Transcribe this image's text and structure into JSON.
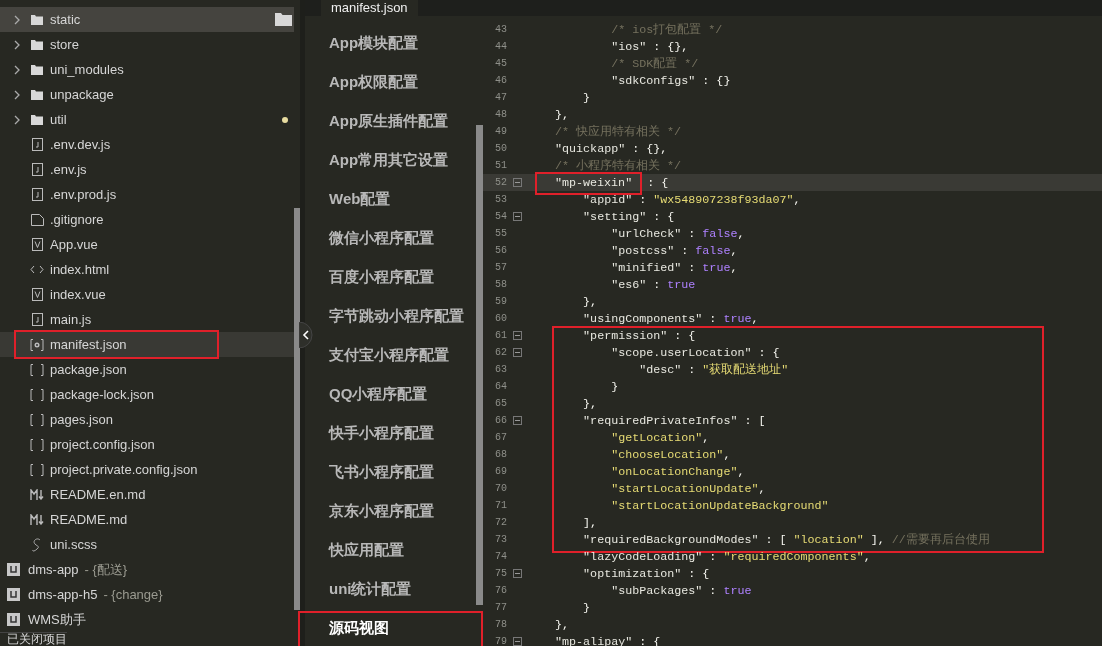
{
  "sidebar": {
    "items": [
      {
        "kind": "folder",
        "label": "static",
        "hovered": true,
        "selected": false,
        "modified": false
      },
      {
        "kind": "folder",
        "label": "store",
        "hovered": false,
        "selected": false,
        "modified": false
      },
      {
        "kind": "folder",
        "label": "uni_modules",
        "hovered": false,
        "selected": false,
        "modified": false
      },
      {
        "kind": "folder",
        "label": "unpackage",
        "hovered": false,
        "selected": false,
        "modified": false
      },
      {
        "kind": "folder",
        "label": "util",
        "hovered": false,
        "selected": false,
        "modified": true
      },
      {
        "kind": "js",
        "label": ".env.dev.js",
        "hovered": false,
        "selected": false,
        "modified": false
      },
      {
        "kind": "js",
        "label": ".env.js",
        "hovered": false,
        "selected": false,
        "modified": false
      },
      {
        "kind": "js",
        "label": ".env.prod.js",
        "hovered": false,
        "selected": false,
        "modified": false
      },
      {
        "kind": "blank",
        "label": ".gitignore",
        "hovered": false,
        "selected": false,
        "modified": false
      },
      {
        "kind": "vue",
        "label": "App.vue",
        "hovered": false,
        "selected": false,
        "modified": false
      },
      {
        "kind": "html",
        "label": "index.html",
        "hovered": false,
        "selected": false,
        "modified": false
      },
      {
        "kind": "vue",
        "label": "index.vue",
        "hovered": false,
        "selected": false,
        "modified": false
      },
      {
        "kind": "js",
        "label": "main.js",
        "hovered": false,
        "selected": false,
        "modified": false
      },
      {
        "kind": "manifest",
        "label": "manifest.json",
        "hovered": false,
        "selected": true,
        "modified": false,
        "annotated": true
      },
      {
        "kind": "json",
        "label": "package.json",
        "hovered": false,
        "selected": false,
        "modified": false
      },
      {
        "kind": "json",
        "label": "package-lock.json",
        "hovered": false,
        "selected": false,
        "modified": false
      },
      {
        "kind": "json",
        "label": "pages.json",
        "hovered": false,
        "selected": false,
        "modified": false
      },
      {
        "kind": "json",
        "label": "project.config.json",
        "hovered": false,
        "selected": false,
        "modified": false
      },
      {
        "kind": "json",
        "label": "project.private.config.json",
        "hovered": false,
        "selected": false,
        "modified": false
      },
      {
        "kind": "md",
        "label": "README.en.md",
        "hovered": false,
        "selected": false,
        "modified": false
      },
      {
        "kind": "md",
        "label": "README.md",
        "hovered": false,
        "selected": false,
        "modified": false
      },
      {
        "kind": "scss",
        "label": "uni.scss",
        "hovered": false,
        "selected": false,
        "modified": false
      }
    ],
    "projects": [
      {
        "name": "dms-app",
        "branch": "- {配送}"
      },
      {
        "name": "dms-app-h5",
        "branch": "- {change}"
      },
      {
        "name": "WMS助手"
      }
    ],
    "closed_projects": "已关闭项目"
  },
  "editor_tab": "manifest.json",
  "nav": [
    {
      "label": "App模块配置",
      "selected": false
    },
    {
      "label": "App权限配置",
      "selected": false
    },
    {
      "label": "App原生插件配置",
      "selected": false
    },
    {
      "label": "App常用其它设置",
      "selected": false
    },
    {
      "label": "Web配置",
      "selected": false
    },
    {
      "label": "微信小程序配置",
      "selected": false
    },
    {
      "label": "百度小程序配置",
      "selected": false
    },
    {
      "label": "字节跳动小程序配置",
      "selected": false
    },
    {
      "label": "支付宝小程序配置",
      "selected": false
    },
    {
      "label": "QQ小程序配置",
      "selected": false
    },
    {
      "label": "快手小程序配置",
      "selected": false
    },
    {
      "label": "飞书小程序配置",
      "selected": false
    },
    {
      "label": "京东小程序配置",
      "selected": false
    },
    {
      "label": "快应用配置",
      "selected": false
    },
    {
      "label": "uni统计配置",
      "selected": false
    },
    {
      "label": "源码视图",
      "selected": true,
      "annotated": true
    }
  ],
  "code": [
    {
      "annotated": false,
      "lines": [
        {
          "number": "43",
          "fold": false,
          "current": false,
          "tokens": [
            {
              "kind": "comment",
              "text": "            /* ios打包配置 */"
            }
          ]
        },
        {
          "number": "44",
          "fold": false,
          "current": false,
          "tokens": [
            {
              "kind": "key",
              "text": "            \"ios\""
            },
            {
              "kind": "punct",
              "text": " : {},"
            }
          ]
        },
        {
          "number": "45",
          "fold": false,
          "current": false,
          "tokens": [
            {
              "kind": "comment",
              "text": "            /* SDK配置 */"
            }
          ]
        },
        {
          "number": "46",
          "fold": false,
          "current": false,
          "tokens": [
            {
              "kind": "key",
              "text": "            \"sdkConfigs\""
            },
            {
              "kind": "punct",
              "text": " : {}"
            }
          ]
        },
        {
          "number": "47",
          "fold": false,
          "current": false,
          "tokens": [
            {
              "kind": "punct",
              "text": "        }"
            }
          ]
        },
        {
          "number": "48",
          "fold": false,
          "current": false,
          "tokens": [
            {
              "kind": "punct",
              "text": "    },"
            }
          ]
        },
        {
          "number": "49",
          "fold": false,
          "current": false,
          "tokens": [
            {
              "kind": "comment",
              "text": "    /* 快应用特有相关 */"
            }
          ]
        },
        {
          "number": "50",
          "fold": false,
          "current": false,
          "tokens": [
            {
              "kind": "key",
              "text": "    \"quickapp\""
            },
            {
              "kind": "punct",
              "text": " : {},"
            }
          ]
        },
        {
          "number": "51",
          "fold": false,
          "current": false,
          "tokens": [
            {
              "kind": "comment",
              "text": "    /* 小程序特有相关 */"
            }
          ]
        },
        {
          "number": "52",
          "fold": true,
          "current": true,
          "tokens": [
            {
              "kind": "key",
              "text": "\"mp-weixin\"",
              "annotated": true
            },
            {
              "kind": "punct",
              "text": " : {"
            }
          ]
        },
        {
          "number": "53",
          "fold": false,
          "current": false,
          "tokens": [
            {
              "kind": "key",
              "text": "        \"appid\""
            },
            {
              "kind": "punct",
              "text": " : "
            },
            {
              "kind": "string",
              "text": "\"wx548907238f93da07\""
            },
            {
              "kind": "punct",
              "text": ","
            }
          ]
        },
        {
          "number": "54",
          "fold": true,
          "current": false,
          "tokens": [
            {
              "kind": "key",
              "text": "        \"setting\""
            },
            {
              "kind": "punct",
              "text": " : {"
            }
          ]
        },
        {
          "number": "55",
          "fold": false,
          "current": false,
          "tokens": [
            {
              "kind": "key",
              "text": "            \"urlCheck\""
            },
            {
              "kind": "punct",
              "text": " : "
            },
            {
              "kind": "literal",
              "text": "false"
            },
            {
              "kind": "punct",
              "text": ","
            }
          ]
        },
        {
          "number": "56",
          "fold": false,
          "current": false,
          "tokens": [
            {
              "kind": "key",
              "text": "            \"postcss\""
            },
            {
              "kind": "punct",
              "text": " : "
            },
            {
              "kind": "literal",
              "text": "false"
            },
            {
              "kind": "punct",
              "text": ","
            }
          ]
        },
        {
          "number": "57",
          "fold": false,
          "current": false,
          "tokens": [
            {
              "kind": "key",
              "text": "            \"minified\""
            },
            {
              "kind": "punct",
              "text": " : "
            },
            {
              "kind": "literal",
              "text": "true"
            },
            {
              "kind": "punct",
              "text": ","
            }
          ]
        },
        {
          "number": "58",
          "fold": false,
          "current": false,
          "tokens": [
            {
              "kind": "key",
              "text": "            \"es6\""
            },
            {
              "kind": "punct",
              "text": " : "
            },
            {
              "kind": "literal",
              "text": "true"
            }
          ]
        },
        {
          "number": "59",
          "fold": false,
          "current": false,
          "tokens": [
            {
              "kind": "punct",
              "text": "        },"
            }
          ]
        },
        {
          "number": "60",
          "fold": false,
          "current": false,
          "tokens": [
            {
              "kind": "key",
              "text": "        \"usingComponents\""
            },
            {
              "kind": "punct",
              "text": " : "
            },
            {
              "kind": "literal",
              "text": "true"
            },
            {
              "kind": "punct",
              "text": ","
            }
          ]
        }
      ]
    },
    {
      "annotated": true,
      "lines": [
        {
          "number": "61",
          "fold": true,
          "current": false,
          "tokens": [
            {
              "kind": "key",
              "text": "        \"permission\""
            },
            {
              "kind": "punct",
              "text": " : {"
            }
          ]
        },
        {
          "number": "62",
          "fold": true,
          "current": false,
          "tokens": [
            {
              "kind": "key",
              "text": "            \"scope.userLocation\""
            },
            {
              "kind": "punct",
              "text": " : {"
            }
          ]
        },
        {
          "number": "63",
          "fold": false,
          "current": false,
          "tokens": [
            {
              "kind": "key",
              "text": "                \"desc\""
            },
            {
              "kind": "punct",
              "text": " : "
            },
            {
              "kind": "string",
              "text": "\"获取配送地址\""
            }
          ]
        },
        {
          "number": "64",
          "fold": false,
          "current": false,
          "tokens": [
            {
              "kind": "punct",
              "text": "            }"
            }
          ]
        },
        {
          "number": "65",
          "fold": false,
          "current": false,
          "tokens": [
            {
              "kind": "punct",
              "text": "        },"
            }
          ]
        },
        {
          "number": "66",
          "fold": true,
          "current": false,
          "tokens": [
            {
              "kind": "key",
              "text": "        \"requiredPrivateInfos\""
            },
            {
              "kind": "punct",
              "text": " : ["
            }
          ]
        },
        {
          "number": "67",
          "fold": false,
          "current": false,
          "tokens": [
            {
              "kind": "string",
              "text": "            \"getLocation\""
            },
            {
              "kind": "punct",
              "text": ","
            }
          ]
        },
        {
          "number": "68",
          "fold": false,
          "current": false,
          "tokens": [
            {
              "kind": "string",
              "text": "            \"chooseLocation\""
            },
            {
              "kind": "punct",
              "text": ","
            }
          ]
        },
        {
          "number": "69",
          "fold": false,
          "current": false,
          "tokens": [
            {
              "kind": "string",
              "text": "            \"onLocationChange\""
            },
            {
              "kind": "punct",
              "text": ","
            }
          ]
        },
        {
          "number": "70",
          "fold": false,
          "current": false,
          "tokens": [
            {
              "kind": "string",
              "text": "            \"startLocationUpdate\""
            },
            {
              "kind": "punct",
              "text": ","
            }
          ]
        },
        {
          "number": "71",
          "fold": false,
          "current": false,
          "tokens": [
            {
              "kind": "string",
              "text": "            \"startLocationUpdateBackground\""
            }
          ]
        },
        {
          "number": "72",
          "fold": false,
          "current": false,
          "tokens": [
            {
              "kind": "punct",
              "text": "        ],"
            }
          ]
        },
        {
          "number": "73",
          "fold": false,
          "current": false,
          "tokens": [
            {
              "kind": "key",
              "text": "        \"requiredBackgroundModes\""
            },
            {
              "kind": "punct",
              "text": " : [ "
            },
            {
              "kind": "string",
              "text": "\"location\""
            },
            {
              "kind": "punct",
              "text": " ], "
            },
            {
              "kind": "comment",
              "text": "//需要再后台使用"
            }
          ]
        }
      ]
    },
    {
      "annotated": false,
      "lines": [
        {
          "number": "74",
          "fold": false,
          "current": false,
          "tokens": [
            {
              "kind": "key",
              "text": "        \"lazyCodeLoading\""
            },
            {
              "kind": "punct",
              "text": " : "
            },
            {
              "kind": "string",
              "text": "\"requiredComponents\""
            },
            {
              "kind": "punct",
              "text": ","
            }
          ]
        },
        {
          "number": "75",
          "fold": true,
          "current": false,
          "tokens": [
            {
              "kind": "key",
              "text": "        \"optimization\""
            },
            {
              "kind": "punct",
              "text": " : {"
            }
          ]
        },
        {
          "number": "76",
          "fold": false,
          "current": false,
          "tokens": [
            {
              "kind": "key",
              "text": "            \"subPackages\""
            },
            {
              "kind": "punct",
              "text": " : "
            },
            {
              "kind": "literal",
              "text": "true"
            }
          ]
        },
        {
          "number": "77",
          "fold": false,
          "current": false,
          "tokens": [
            {
              "kind": "punct",
              "text": "        }"
            }
          ]
        },
        {
          "number": "78",
          "fold": false,
          "current": false,
          "tokens": [
            {
              "kind": "punct",
              "text": "    },"
            }
          ]
        },
        {
          "number": "79",
          "fold": true,
          "current": false,
          "tokens": [
            {
              "kind": "key",
              "text": "    \"mp-alipay\""
            },
            {
              "kind": "punct",
              "text": " : {"
            }
          ]
        }
      ]
    }
  ]
}
